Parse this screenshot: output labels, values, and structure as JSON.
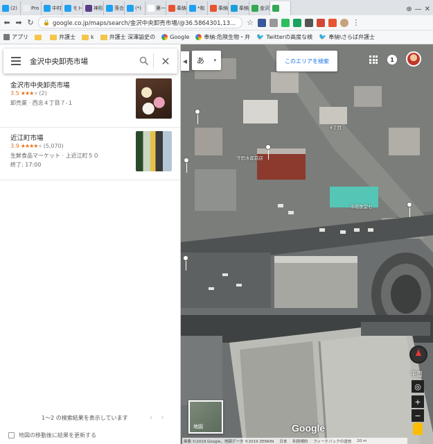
{
  "browser": {
    "tabs": [
      {
        "label": "(2)",
        "color": "#1da1f2"
      },
      {
        "label": "Pro",
        "color": "#eeeeee"
      },
      {
        "label": "中村",
        "color": "#1da1f2"
      },
      {
        "label": "モト",
        "color": "#1da1f2"
      },
      {
        "label": "神形",
        "color": "#5b3d87"
      },
      {
        "label": "落合",
        "color": "#1da1f2"
      },
      {
        "label": "(*)",
        "color": "#1da1f2"
      },
      {
        "label": "第一",
        "color": "#ffffff"
      },
      {
        "label": "奉納",
        "color": "#e8542f"
      },
      {
        "label": "*和",
        "color": "#1da1f2"
      },
      {
        "label": "奉納",
        "color": "#e8542f"
      },
      {
        "label": "奉納",
        "color": "#1aa0d8"
      },
      {
        "label": "金沢",
        "color": "#34a853"
      },
      {
        "label": "",
        "color": "#34a853"
      }
    ],
    "url": "google.co.jp/maps/search/金沢中央卸売市場/@36.5864301,13...",
    "bookmarks": [
      {
        "label": "アプリ",
        "icon": "apps-icon"
      },
      {
        "label": "",
        "icon": "folder-icon"
      },
      {
        "label": "弁護士",
        "icon": "folder-icon"
      },
      {
        "label": "k",
        "icon": "folder-icon"
      },
      {
        "label": "弁護士 深澤諭史の",
        "icon": "folder-icon"
      },
      {
        "label": "Google",
        "icon": "google-icon"
      },
      {
        "label": "奉納:危険生物・弁",
        "icon": "google-icon"
      },
      {
        "label": "Twitterの高度な検",
        "icon": "twitter-icon"
      },
      {
        "label": "奉納\\さらば弁護士",
        "icon": "twitter-icon"
      }
    ]
  },
  "search": {
    "query": "金沢中央卸売市場"
  },
  "results": [
    {
      "name": "金沢市中央卸売市場",
      "rating": "3.5",
      "reviews": "(2)",
      "stars_full": "★★★",
      "stars_off": "★",
      "category_address": "卸売業 · 西念４丁目７-１",
      "hours": ""
    },
    {
      "name": "近江町市場",
      "rating": "3.9",
      "reviews": "(5,070)",
      "stars_full": "★★★★",
      "stars_off": "★",
      "category_address": "生鮮食品マーケット · 上近江町５０",
      "hours": "終了: 17:00"
    }
  ],
  "footer": {
    "count_text": "1〜2 の検索結果を表示しています",
    "update_label": "地図の移動後に結果を更新する"
  },
  "map": {
    "ime_label": "あ",
    "search_area_label": "このエリアを検索",
    "notification_count": "1",
    "flat_label": "平面",
    "minimap_label": "地図",
    "logo": "Google",
    "labels": {
      "district": "4丁目",
      "building": "守田水産前店",
      "market": "市場食堂セ"
    },
    "attribution": [
      "画像 ©2019 Google、地図データ ©2019 ZENRIN",
      "日本",
      "利用規約",
      "フィードバックの送信",
      "20 m"
    ]
  }
}
